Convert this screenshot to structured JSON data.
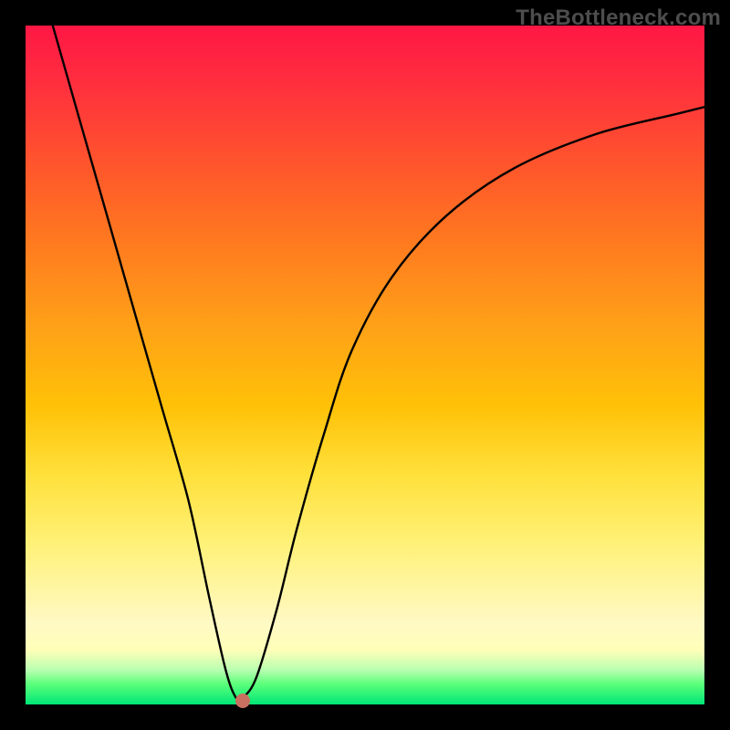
{
  "watermark": "TheBottleneck.com",
  "colors": {
    "frame": "#000000",
    "curve": "#000000",
    "dot": "#c97060"
  },
  "chart_data": {
    "type": "line",
    "title": "",
    "xlabel": "",
    "ylabel": "",
    "xlim": [
      0,
      100
    ],
    "ylim": [
      0,
      100
    ],
    "grid": false,
    "legend": false,
    "annotations": [],
    "series": [
      {
        "name": "bottleneck-curve",
        "x": [
          4,
          8,
          12,
          16,
          20,
          24,
          27,
          29.5,
          31,
          32,
          34,
          37,
          40,
          44,
          48,
          54,
          62,
          72,
          84,
          96,
          100
        ],
        "y": [
          100,
          86,
          72,
          58,
          44,
          30,
          16,
          5,
          1,
          1,
          4,
          14,
          26,
          40,
          52,
          63,
          72,
          79,
          84,
          87,
          88
        ]
      }
    ],
    "marker": {
      "x": 32,
      "y": 0.5,
      "color": "#c97060"
    }
  }
}
